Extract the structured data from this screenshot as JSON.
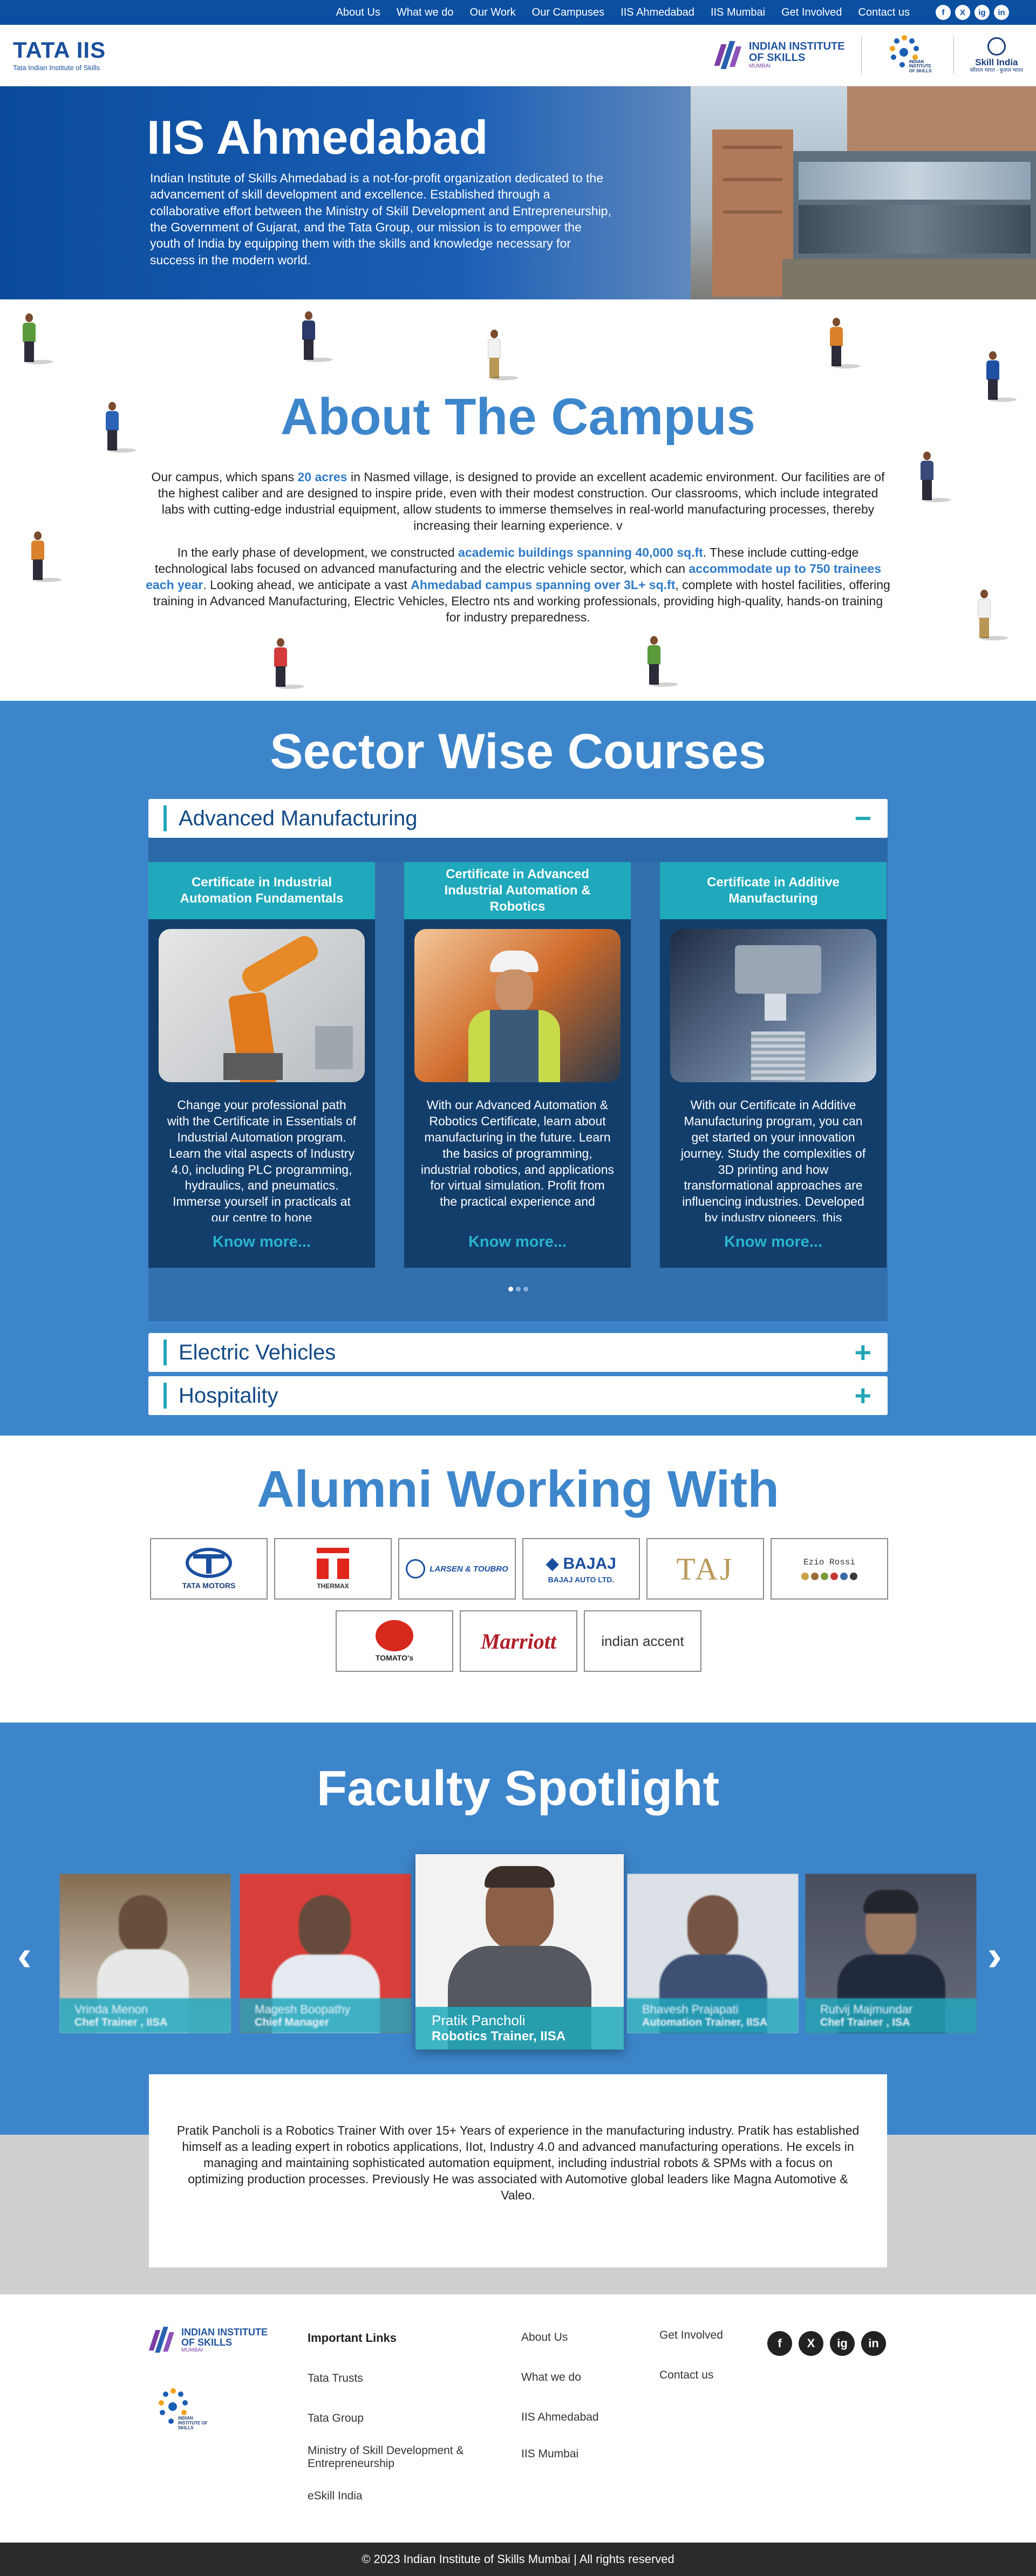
{
  "topnav": {
    "links": [
      "About Us",
      "What we do",
      "Our Work",
      "Our Campuses",
      "IIS Ahmedabad",
      "IIS Mumbai",
      "Get Involved",
      "Contact us"
    ],
    "social": [
      "f",
      "X",
      "ig",
      "in"
    ]
  },
  "header": {
    "tata_brand": "TATA IIS",
    "tata_sub": "Tata Indian Institute of Skills",
    "iis_logo_line1": "INDIAN INSTITUTE",
    "iis_logo_line2": "OF SKILLS",
    "iis_logo_sub": "MUMBAI",
    "dots_logo_text": "INDIAN INSTITUTE OF SKILLS",
    "skill_india": "Skill India",
    "skill_india_sub": "कौशल भारत - कुशल भारत"
  },
  "hero": {
    "title": "IIS Ahmedabad",
    "description": "Indian Institute of Skills Ahmedabad is a not-for-profit organization dedicated to the advancement of skill development and excellence. Established through a collaborative effort between the Ministry of Skill Development and Entrepreneurship, the Government of Gujarat, and the Tata Group, our mission is to empower the youth of India by equipping them with the skills and knowledge necessary for success in the modern world."
  },
  "about": {
    "title": "About The Campus",
    "p1_a": "Our campus, which spans ",
    "p1_hl": "20 acres",
    "p1_b": " in Nasmed village, is designed to provide an excellent academic environment. Our facilities are of the highest caliber and are designed to inspire pride, even with their modest construction. Our classrooms, which include integrated labs with cutting-edge industrial equipment, allow students to immerse themselves in real-world manufacturing processes, thereby increasing their learning experience. v",
    "p2_a": "In the early phase of development, we constructed ",
    "p2_hl1": "academic buildings spanning 40,000 sq.ft",
    "p2_b": ". These include cutting-edge technological labs focused on advanced manufacturing and the electric vehicle sector, which can ",
    "p2_hl2": "accommodate up to 750 trainees each year",
    "p2_c": ". Looking ahead, we anticipate a vast ",
    "p2_hl3": "Ahmedabad campus spanning over 3L+ sq.ft",
    "p2_d": ", complete with hostel facilities, offering training in Advanced Manufacturing, Electric Vehicles, Electro nts and working professionals, providing high-quality, hands-on training for industry preparedness."
  },
  "courses": {
    "title": "Sector Wise Courses",
    "sectors": [
      {
        "label": "Advanced Manufacturing",
        "toggle": "−"
      },
      {
        "label": "Electric Vehicles",
        "toggle": "+"
      },
      {
        "label": "Hospitality",
        "toggle": "+"
      }
    ],
    "cards": [
      {
        "title": "Certificate in Industrial Automation Fundamentals",
        "description": "Change your professional path with the Certificate in Essentials of Industrial Automation program. Learn the vital aspects of Industry 4.0, including PLC programming, hydraulics, and pneumatics. Immerse yourself in practicals at our centre to hone",
        "more": "Know more..."
      },
      {
        "title": "Certificate in Advanced Industrial Automation & Robotics",
        "description": "With our Advanced Automation & Robotics Certificate, learn about manufacturing in the future. Learn the basics of programming, industrial robotics, and applications for virtual simulation. Profit from the practical experience and",
        "more": "Know more..."
      },
      {
        "title": "Certificate in Additive Manufacturing",
        "description": "With our Certificate in Additive Manufacturing program, you can get started on your innovation journey. Study the complexities of 3D printing and how transformational approaches are influencing industries. Developed by industry pioneers, this",
        "more": "Know more..."
      }
    ]
  },
  "alumni": {
    "title": "Alumni Working With",
    "logos": [
      {
        "name": "TATA MOTORS"
      },
      {
        "name": "THERMAX"
      },
      {
        "name": "LARSEN & TOUBRO"
      },
      {
        "name": "BAJAJ AUTO LTD."
      },
      {
        "name": "TAJ"
      },
      {
        "name": "Ezio Rossi"
      },
      {
        "name": "TOMATO's"
      },
      {
        "name": "Marriott"
      },
      {
        "name": "indian accent"
      }
    ]
  },
  "faculty": {
    "title": "Faculty Spotlight",
    "members": [
      {
        "name": "Vrinda Menon",
        "role": "Chef Trainer , IISA"
      },
      {
        "name": "Magesh Boopathy",
        "role": "Chief Manager"
      },
      {
        "name": "Pratik Pancholi",
        "role": "Robotics Trainer, IISA"
      },
      {
        "name": "Bhavesh Prajapati",
        "role": "Automation Trainer, IISA"
      },
      {
        "name": "Rutvij Majmundar",
        "role": "Chef Trainer , ISA"
      }
    ],
    "bio": "Pratik Pancholi is a Robotics Trainer With over 15+ Years of experience in the manufacturing industry. Pratik has established himself as a leading expert in robotics applications, IIot, Industry 4.0 and advanced manufacturing operations. He excels in managing and maintaining sophisticated automation equipment, including industrial robots & SPMs with a focus on optimizing production processes. Previously He was associated with Automotive global leaders like Magna Automotive & Valeo."
  },
  "footer": {
    "important_links_title": "Important Links",
    "col1": [
      "Tata Trusts",
      "Tata Group",
      "Ministry of Skill Development & Entrepreneurship",
      "eSkill India"
    ],
    "col2": [
      "About Us",
      "What we do",
      "IIS Ahmedabad",
      "IIS Mumbai"
    ],
    "col3": [
      "Get Involved",
      "Contact us"
    ],
    "copyright": "© 2023 Indian Institute of Skills Mumbai | All rights reserved"
  }
}
